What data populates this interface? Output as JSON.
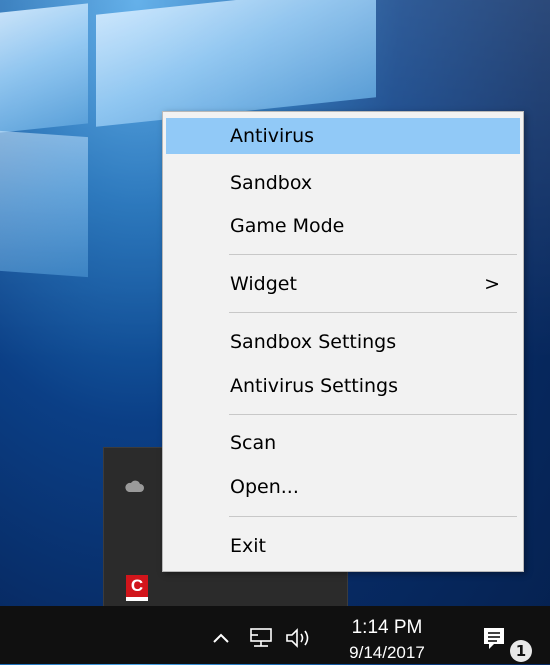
{
  "menu": {
    "items": [
      {
        "label": "Antivirus",
        "highlighted": true
      },
      {
        "label": "Sandbox"
      },
      {
        "label": "Game Mode"
      },
      {
        "label": "Widget",
        "submenu_arrow": ">"
      },
      {
        "label": "Sandbox Settings"
      },
      {
        "label": "Antivirus Settings"
      },
      {
        "label": "Scan"
      },
      {
        "label": "Open..."
      },
      {
        "label": "Exit"
      }
    ]
  },
  "tray_flyout": {
    "icons": [
      "onedrive-cloud-icon",
      "comodo-icon"
    ],
    "comodo_letter": "C"
  },
  "taskbar": {
    "time": "1:14 PM",
    "date": "9/14/2017",
    "notification_count": "1",
    "icons": [
      "chevron-up-icon",
      "network-icon",
      "volume-icon",
      "action-center-icon"
    ]
  },
  "colors": {
    "highlight": "#91c9f7",
    "menu_bg": "#f2f2f2",
    "taskbar_bg": "#101010",
    "comodo_red": "#d1151b"
  }
}
